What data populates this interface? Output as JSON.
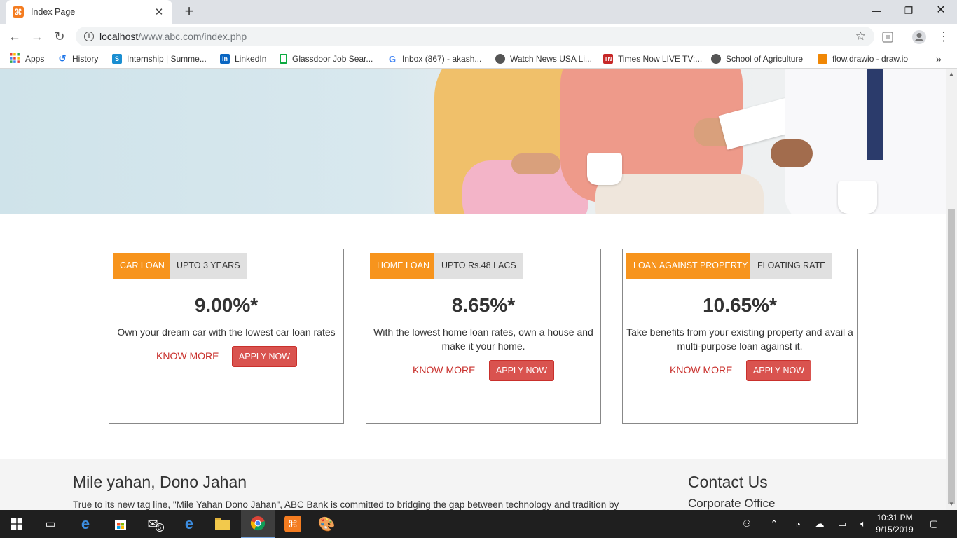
{
  "browser": {
    "tab_title": "Index Page",
    "favicon_glyph": "⌘",
    "url_host": "localhost",
    "url_path": "/www.abc.com/index.php"
  },
  "bookmarks": [
    {
      "label": "Apps",
      "icon": "apps-grid-icon",
      "color": "#e94235"
    },
    {
      "label": "History",
      "icon": "history-icon",
      "color": "#1a73e8"
    },
    {
      "label": "Internship | Summe...",
      "icon": "internshala-icon",
      "color": "#1a8ed1"
    },
    {
      "label": "LinkedIn",
      "icon": "linkedin-icon",
      "color": "#0a66c2"
    },
    {
      "label": "Glassdoor Job Sear...",
      "icon": "glassdoor-icon",
      "color": "#0caa41"
    },
    {
      "label": "Inbox (867) - akash...",
      "icon": "google-icon",
      "color": "#4285f4"
    },
    {
      "label": "Watch News USA Li...",
      "icon": "globe-icon",
      "color": "#444444"
    },
    {
      "label": "Times Now LIVE TV:...",
      "icon": "timesnow-icon",
      "color": "#c62828"
    },
    {
      "label": "School of Agriculture",
      "icon": "globe-icon",
      "color": "#444444"
    },
    {
      "label": "flow.drawio - draw.io",
      "icon": "drawio-icon",
      "color": "#f08705"
    }
  ],
  "loans": [
    {
      "tag": "CAR LOAN",
      "term": "UPTO 3 YEARS",
      "rate": "9.00%*",
      "description": "Own your dream car with the lowest car loan rates",
      "know_more": "KNOW MORE",
      "apply": "APPLY NOW"
    },
    {
      "tag": "HOME LOAN",
      "term": "UPTO Rs.48 LACS",
      "rate": "8.65%*",
      "description": "With the lowest home loan rates, own a house and make it your home.",
      "know_more": "KNOW MORE",
      "apply": "APPLY NOW"
    },
    {
      "tag": "LOAN AGAINST PROPERTY",
      "term": "FLOATING RATE",
      "rate": "10.65%*",
      "description": "Take benefits from your existing property and avail a multi-purpose loan against it.",
      "know_more": "KNOW MORE",
      "apply": "APPLY NOW"
    }
  ],
  "footer": {
    "tagline": "Mile yahan, Dono Jahan",
    "text": "True to its new tag line, \"Mile Yahan Dono Jahan\", ABC Bank is committed to bridging the gap between technology and tradition by",
    "contact_title": "Contact Us",
    "corporate_office": "Corporate Office"
  },
  "taskbar": {
    "mail_badge": "5",
    "time": "10:31 PM",
    "date": "9/15/2019"
  },
  "colors": {
    "accent_orange": "#f7941d",
    "apply_red": "#d9534f",
    "know_more_red": "#c9302c"
  }
}
